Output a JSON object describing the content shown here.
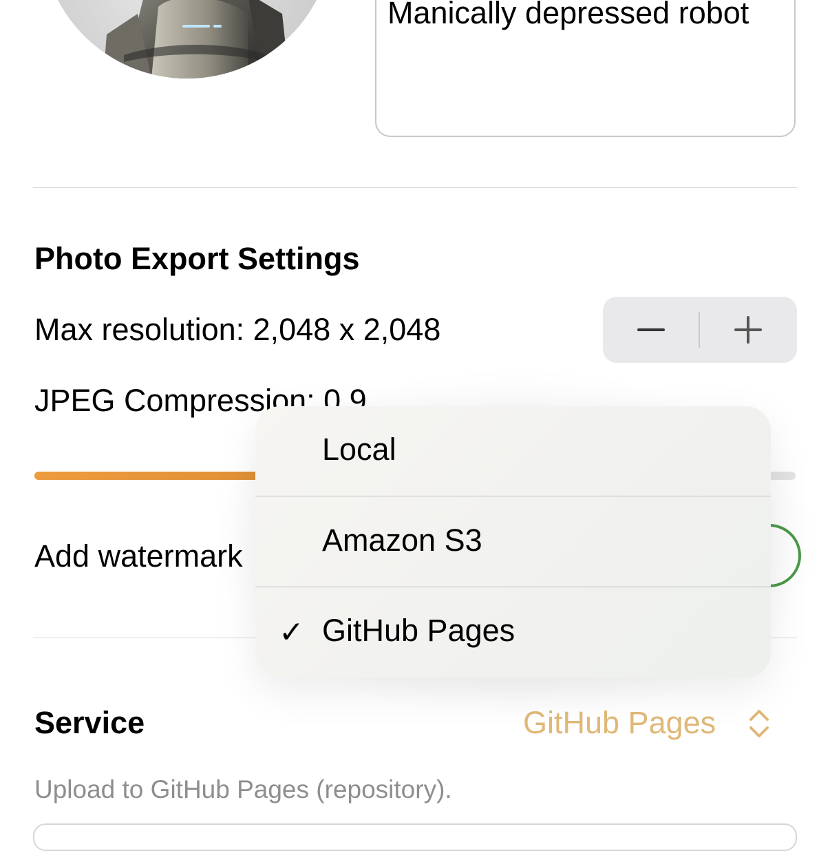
{
  "profile": {
    "bio": "Manically depressed robot"
  },
  "export_settings": {
    "title": "Photo Export Settings",
    "max_resolution_label": "Max resolution: 2,048 x 2,048",
    "stepper_minus": "−",
    "stepper_plus": "+",
    "jpeg_compression_label": "JPEG Compression: 0.9",
    "jpeg_compression_value": 0.9,
    "watermark_label": "Add watermark",
    "watermark_enabled": true
  },
  "service": {
    "label": "Service",
    "selected": "GitHub Pages",
    "help": "Upload to GitHub Pages (repository).",
    "options": [
      {
        "label": "Local",
        "checked": false
      },
      {
        "label": "Amazon S3",
        "checked": false
      },
      {
        "label": "GitHub Pages",
        "checked": true
      }
    ],
    "check_glyph": "✓"
  },
  "colors": {
    "accent": "#e0b878",
    "slider_fill": "#ec9c3c",
    "toggle_on": "#4a9a48"
  },
  "icons": {
    "stepper_minus": "minus-icon",
    "stepper_plus": "plus-icon",
    "service_chevron": "chevron-up-down-icon",
    "menu_check": "checkmark-icon"
  }
}
